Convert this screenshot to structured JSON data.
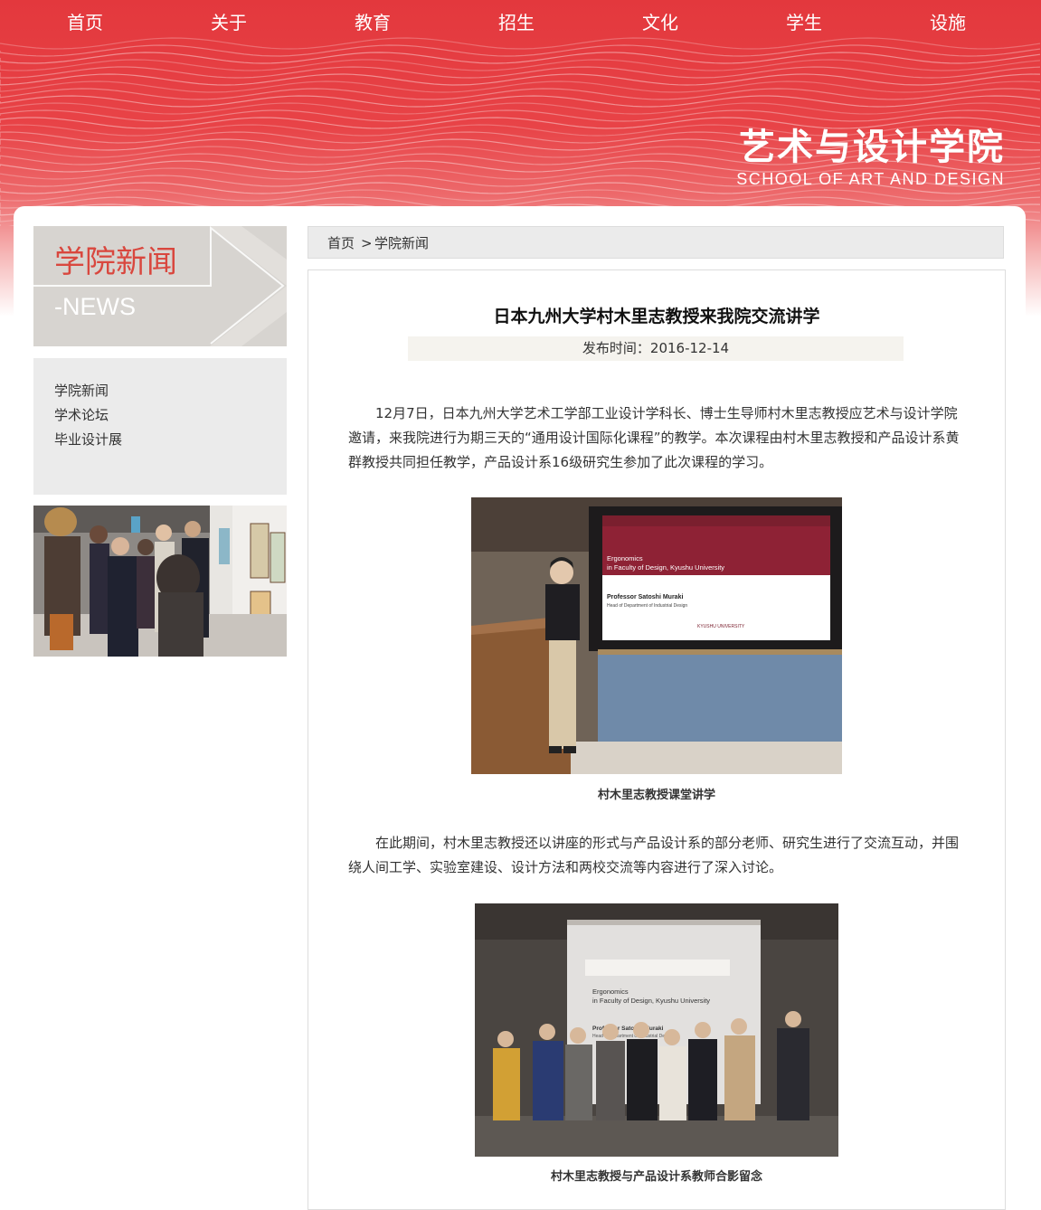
{
  "nav": {
    "items": [
      {
        "label": "首页"
      },
      {
        "label": "关于"
      },
      {
        "label": "教育"
      },
      {
        "label": "招生"
      },
      {
        "label": "文化"
      },
      {
        "label": "学生"
      },
      {
        "label": "设施"
      }
    ]
  },
  "logo": {
    "name_cn": "艺术与设计学院",
    "name_en": "SCHOOL OF ART AND DESIGN"
  },
  "sidebar": {
    "title": "学院新闻",
    "subtitle": "-NEWS",
    "menu": [
      {
        "label": "学院新闻"
      },
      {
        "label": "学术论坛"
      },
      {
        "label": "毕业设计展"
      }
    ]
  },
  "breadcrumb": {
    "home": "首页",
    "separator": ">",
    "current": "学院新闻"
  },
  "article": {
    "title": "日本九州大学村木里志教授来我院交流讲学",
    "date": "发布时间：2016-12-14",
    "paragraph1": "12月7日，日本九州大学艺术工学部工业设计学科长、博士生导师村木里志教授应艺术与设计学院邀请，来我院进行为期三天的“通用设计国际化课程”的教学。本次课程由村木里志教授和产品设计系黄群教授共同担任教学，产品设计系16级研究生参加了此次课程的学习。",
    "caption1": "村木里志教授课堂讲学",
    "paragraph2": "在此期间，村木里志教授还以讲座的形式与产品设计系的部分老师、研究生进行了交流互动，并围绕人间工学、实验室建设、设计方法和两校交流等内容进行了深入讨论。",
    "caption2": "村木里志教授与产品设计系教师合影留念"
  },
  "slides": {
    "slide1": {
      "line1": "Ergonomics",
      "line2": "in Faculty of Design, Kyushu University",
      "line3": "Professor Satoshi Muraki",
      "line4": "Head of Department of Industrial Design",
      "line5": "KYUSHU UNIVERSITY"
    },
    "slide2": {
      "line1": "Ergonomics",
      "line2": "in Faculty of Design, Kyushu University",
      "line3": "Professor Satoshi Muraki",
      "line4": "Head of Department of Industrial Design"
    }
  },
  "colors": {
    "brand_red": "#e3383d",
    "sidebar_title": "#d9473e",
    "sidebar_bg": "#d7d4d0",
    "menu_bg": "#ebebeb"
  }
}
